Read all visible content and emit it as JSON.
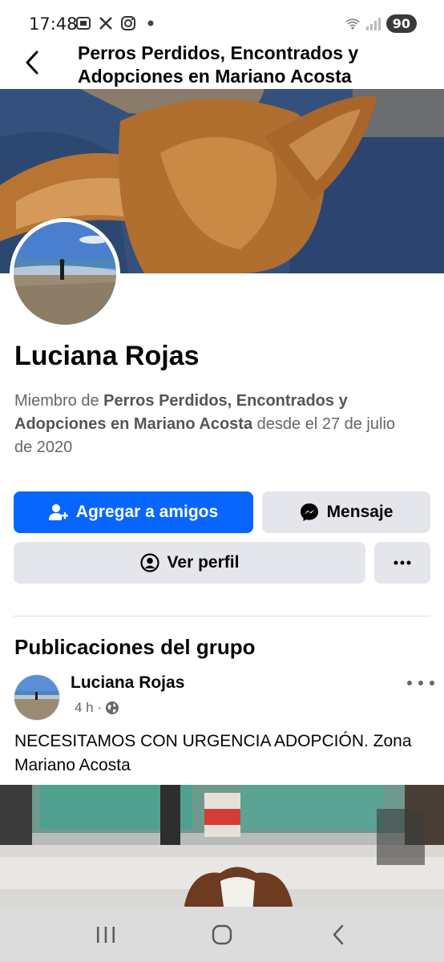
{
  "status_bar": {
    "time": "17:48",
    "battery": "90",
    "icons": [
      "screenshot-icon",
      "x-icon",
      "instagram-icon",
      "dot-icon",
      "wifi-icon",
      "signal-icon"
    ]
  },
  "header": {
    "title": "Perros Perdidos, Encontrados y Adopciones en Mariano Acosta"
  },
  "profile": {
    "name": "Luciana Rojas",
    "member_prefix": "Miembro de ",
    "member_group": "Perros Perdidos, Encontrados y Adopciones en Mariano Acosta",
    "member_suffix": " desde el 27 de julio de 2020"
  },
  "actions": {
    "add_friend": "Agregar a amigos",
    "message": "Mensaje",
    "view_profile": "Ver perfil"
  },
  "section": {
    "title": "Publicaciones del grupo"
  },
  "post": {
    "author": "Luciana Rojas",
    "time": "4 h ·",
    "text": "NECESITAMOS CON URGENCIA ADOPCIÓN. Zona Mariano Acosta"
  },
  "colors": {
    "primary": "#0866ff",
    "secondary_bg": "#e4e6eb",
    "muted_text": "#65676b",
    "nav_bar": "#dcdcdc"
  }
}
